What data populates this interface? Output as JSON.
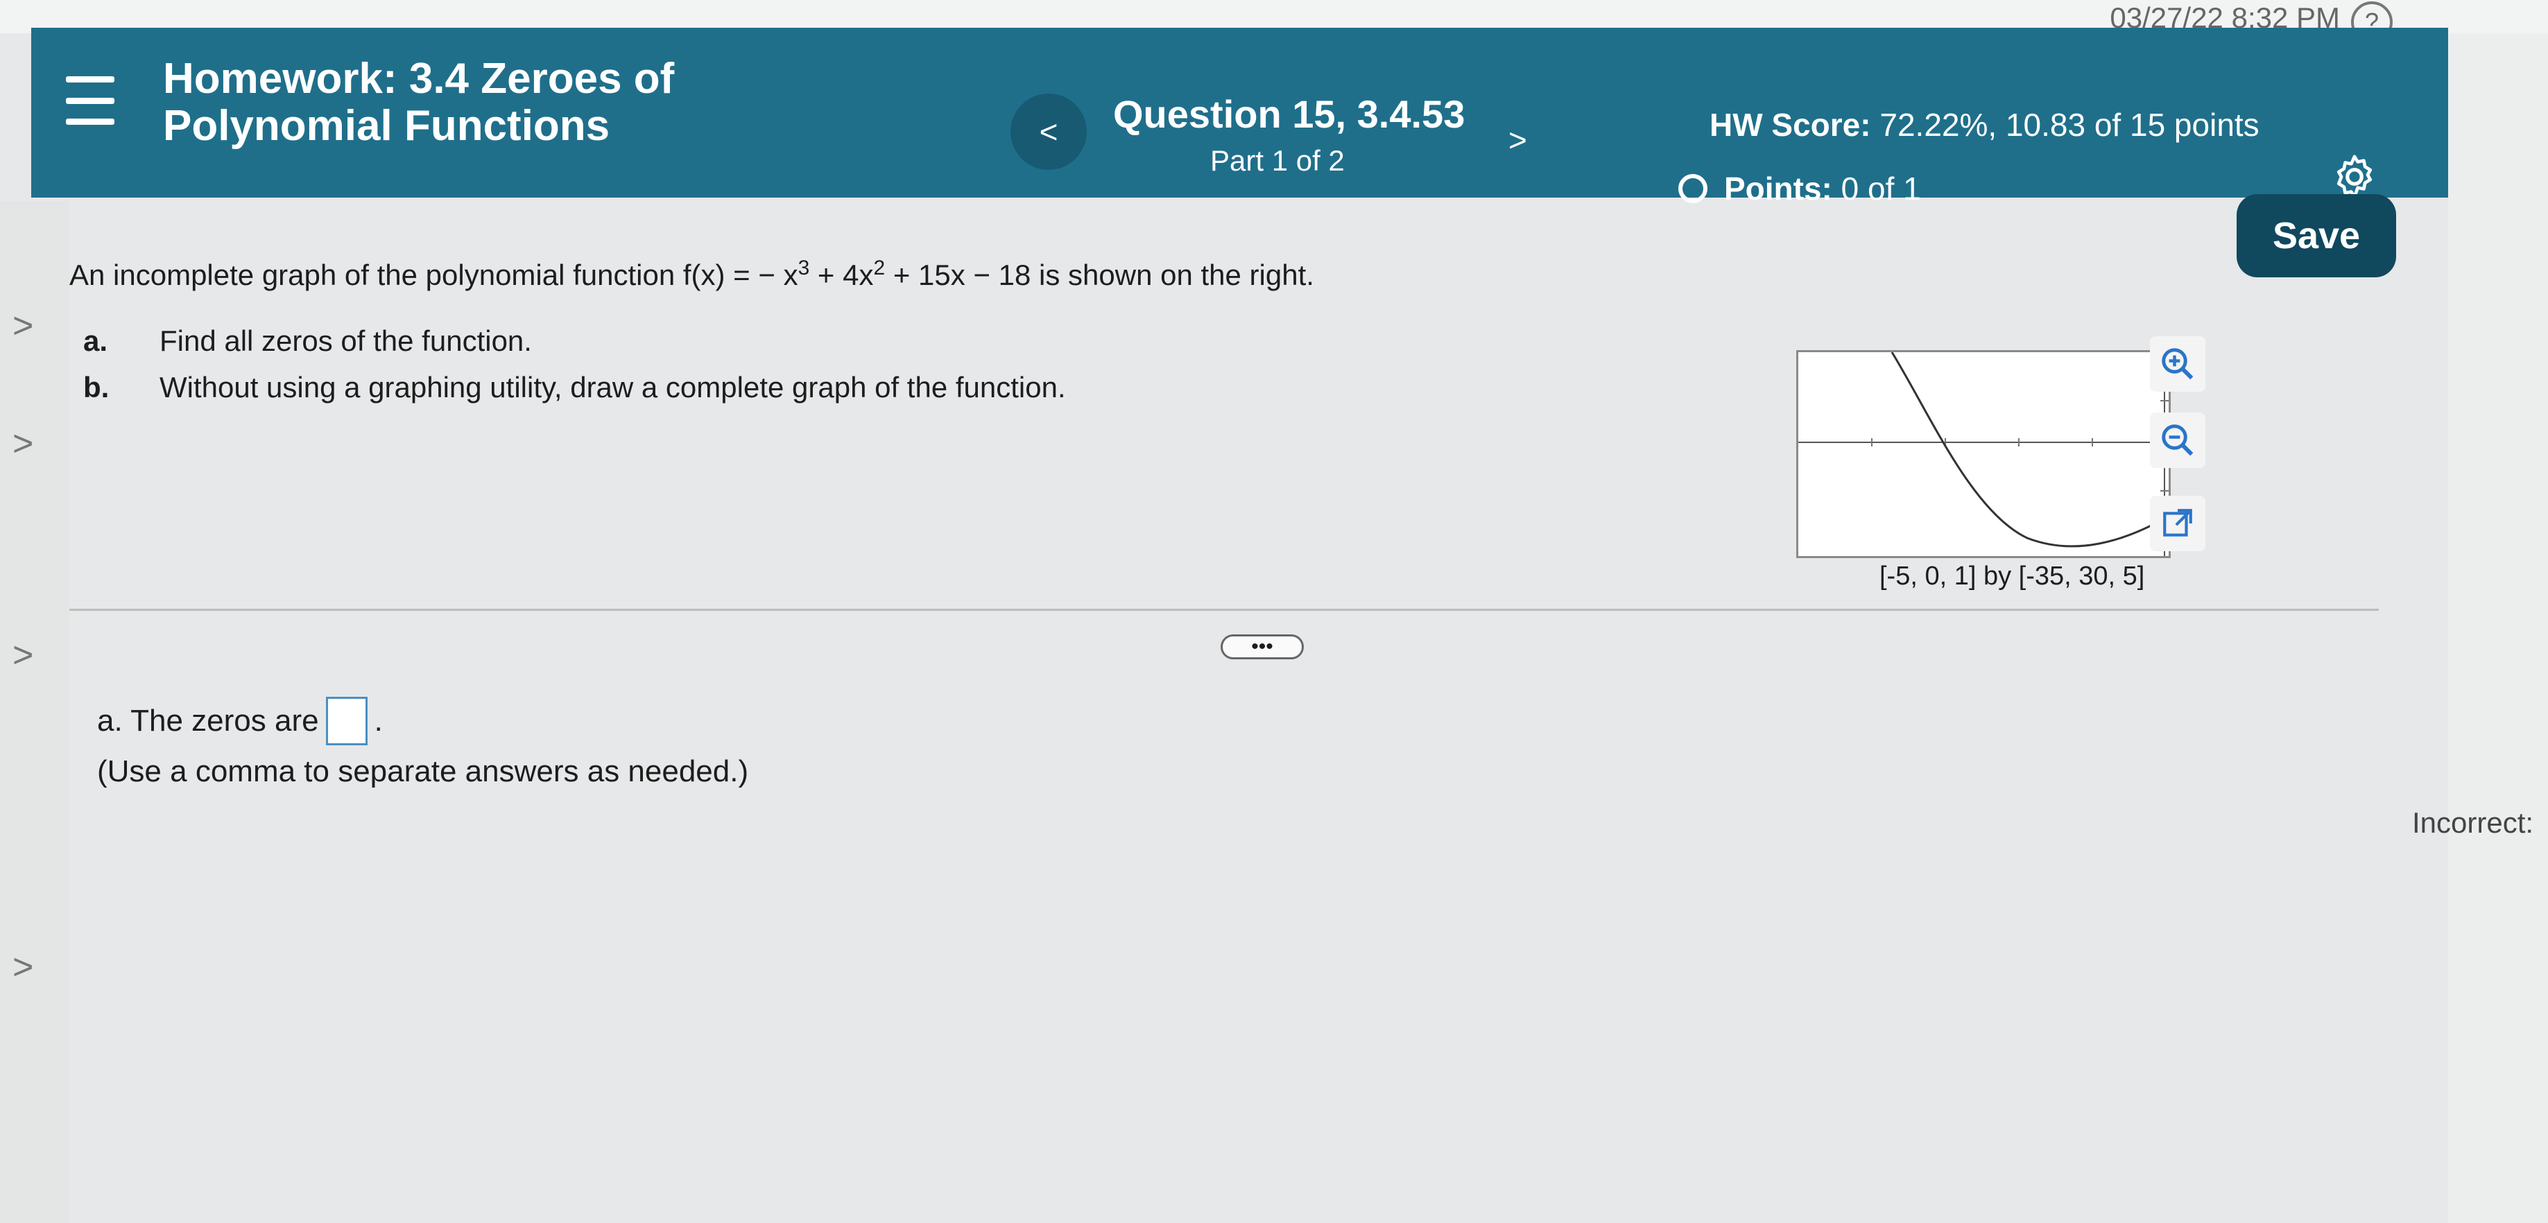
{
  "system": {
    "clock": "03/27/22 8:32 PM"
  },
  "header": {
    "title": "Homework: 3.4 Zeroes of Polynomial Functions",
    "question_title": "Question 15, 3.4.53",
    "question_part": "Part 1 of 2",
    "prev_label": "<",
    "next_label": ">",
    "hw_score_label": "HW Score:",
    "hw_score_value": "72.22%, 10.83 of 15 points",
    "points_label": "Points:",
    "points_value": "0 of 1",
    "save_label": "Save"
  },
  "question": {
    "intro_prefix": "An incomplete graph of the polynomial function f(x) = − x",
    "exp3": "3",
    "mid": " + 4x",
    "exp2": "2",
    "intro_suffix": " + 15x − 18 is shown on the right.",
    "item_a_label": "a.",
    "item_a_text": "Find all zeros of the function.",
    "item_b_label": "b.",
    "item_b_text": "Without using a graphing utility, draw a complete graph of the function."
  },
  "graph": {
    "caption": "[-5, 0, 1] by [-35, 30, 5]",
    "tools": [
      "zoom-in-icon",
      "zoom-out-icon",
      "popout-icon"
    ]
  },
  "answer": {
    "prefix": "a. The zeros are",
    "suffix": ".",
    "hint": "(Use a comma to separate answers as needed.)"
  },
  "side": {
    "incorrect_label": "Incorrect:"
  },
  "colors": {
    "header_bg": "#1f6f8b",
    "save_bg": "#10485e",
    "input_border": "#4a90c2"
  }
}
